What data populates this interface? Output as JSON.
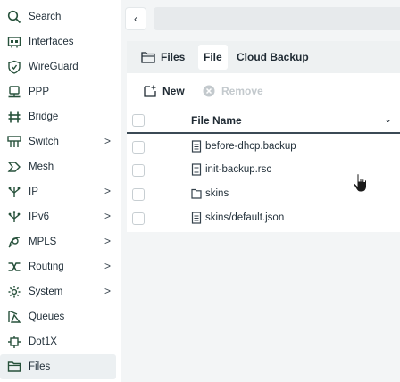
{
  "sidebar": {
    "items": [
      {
        "label": "Search",
        "icon": "search-icon"
      },
      {
        "label": "Interfaces",
        "icon": "interfaces-icon"
      },
      {
        "label": "WireGuard",
        "icon": "wireguard-icon"
      },
      {
        "label": "PPP",
        "icon": "ppp-icon"
      },
      {
        "label": "Bridge",
        "icon": "bridge-icon"
      },
      {
        "label": "Switch",
        "icon": "switch-icon",
        "chevron": ">"
      },
      {
        "label": "Mesh",
        "icon": "mesh-icon"
      },
      {
        "label": "IP",
        "icon": "ip-icon",
        "chevron": ">"
      },
      {
        "label": "IPv6",
        "icon": "ipv6-icon",
        "chevron": ">"
      },
      {
        "label": "MPLS",
        "icon": "mpls-icon",
        "chevron": ">"
      },
      {
        "label": "Routing",
        "icon": "routing-icon",
        "chevron": ">"
      },
      {
        "label": "System",
        "icon": "system-icon",
        "chevron": ">"
      },
      {
        "label": "Queues",
        "icon": "queues-icon"
      },
      {
        "label": "Dot1X",
        "icon": "dot1x-icon"
      },
      {
        "label": "Files",
        "icon": "files-icon",
        "active": true
      }
    ]
  },
  "header": {
    "collapse_label": "‹"
  },
  "tabs": [
    {
      "label": "Files",
      "icon": "folder-icon"
    },
    {
      "label": "File"
    },
    {
      "label": "Cloud Backup"
    }
  ],
  "toolbar": {
    "new_label": "New",
    "remove_label": "Remove"
  },
  "table": {
    "column_header": "File Name",
    "rows": [
      {
        "name": "before-dhcp.backup",
        "icon": "file-icon"
      },
      {
        "name": "init-backup.rsc",
        "icon": "file-icon"
      },
      {
        "name": "skins",
        "icon": "folder-icon"
      },
      {
        "name": "skins/default.json",
        "icon": "file-icon"
      }
    ]
  },
  "colors": {
    "accent_green": "#27513b",
    "sidebar_active_bg": "#ecf0f2",
    "main_bg": "#f3f5f6",
    "disabled_text": "#c3c9cd"
  }
}
